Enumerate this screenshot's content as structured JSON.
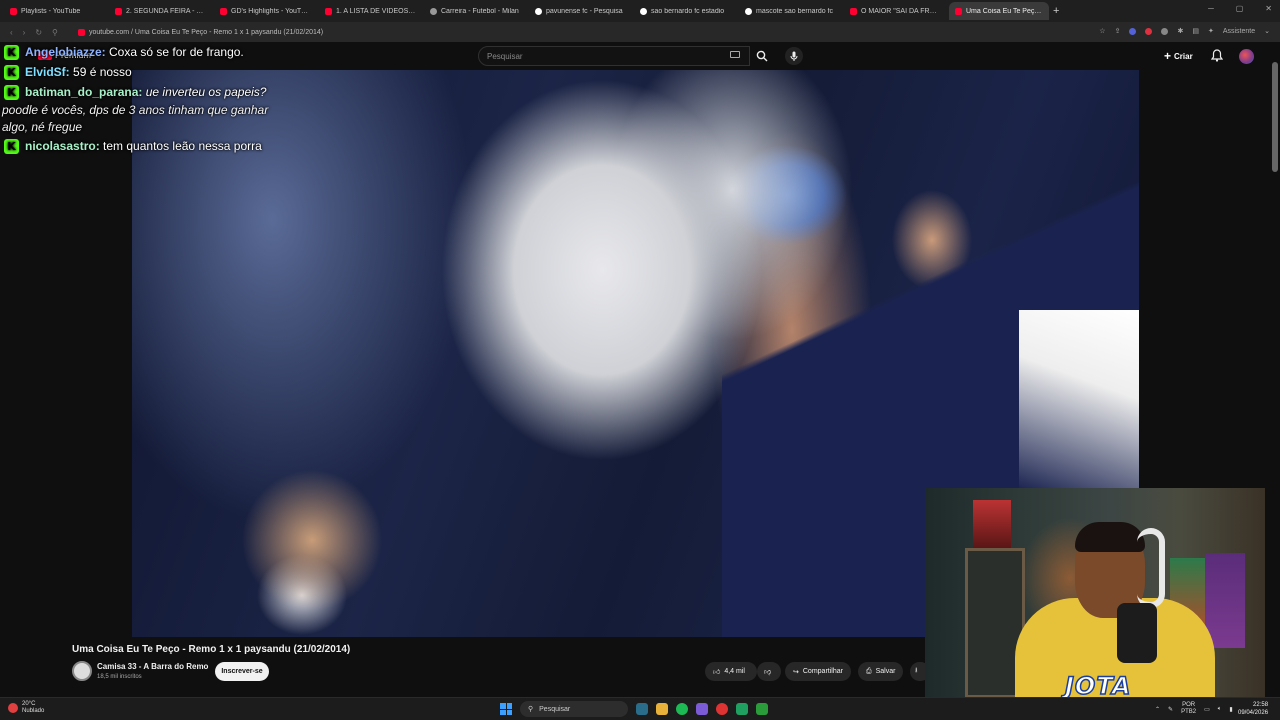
{
  "browser": {
    "tabs": [
      {
        "label": "Playlists - YouTube",
        "icon": "youtube-icon",
        "active": false
      },
      {
        "label": "2. SEGUNDA FEIRA - YouTube",
        "icon": "youtube-icon",
        "active": false
      },
      {
        "label": "GD's Highlights - YouTube",
        "icon": "youtube-icon",
        "active": false
      },
      {
        "label": "1. A LISTA DE VIDEOS PA",
        "icon": "youtube-icon",
        "active": false
      },
      {
        "label": "Carreira - Futebol - Milan",
        "icon": "page-icon",
        "active": false
      },
      {
        "label": "pavunense fc - Pesquisa",
        "icon": "google-icon",
        "active": false
      },
      {
        "label": "sao bernardo fc estadio",
        "icon": "google-icon",
        "active": false
      },
      {
        "label": "mascote sao bernardo fc",
        "icon": "google-icon",
        "active": false
      },
      {
        "label": "O MAIOR \"SAI DA FRENTE\"",
        "icon": "youtube-icon",
        "active": false
      },
      {
        "label": "Uma Coisa Eu Te Peço - R",
        "icon": "youtube-icon",
        "active": true
      }
    ],
    "new_tab": "+",
    "url": "youtube.com / Uma Coisa Eu Te Peço - Remo 1 x 1 paysandu (21/02/2014)",
    "assistant_label": "Assistente"
  },
  "youtube": {
    "logo_label": "Premium",
    "search_placeholder": "Pesquisar",
    "create_label": "Criar",
    "video_title": "Uma Coisa Eu Te Peço - Remo 1 x 1 paysandu (21/02/2014)",
    "channel_name": "Camisa 33 - A Barra do Remo",
    "channel_subs": "18,5 mil inscritos",
    "subscribe_label": "Inscrever-se",
    "likes": "4,4 mil",
    "share_label": "Compartilhar",
    "save_label": "Salvar"
  },
  "chat": [
    {
      "user": "Angelobiazze:",
      "user_color": "#8fb4ff",
      "text": "Coxa só se for de frango.",
      "italic": false
    },
    {
      "user": "ElvidSf:",
      "user_color": "#7fe0ff",
      "text": "59 é nosso",
      "italic": false
    },
    {
      "user": "batiman_do_parana:",
      "user_color": "#a8f0c8",
      "text": "ue inverteu os papeis?",
      "italic": true,
      "wrap": [
        "poodle é vocês, dps de 3 anos tinham que ganhar",
        "algo, né fregue"
      ]
    },
    {
      "user": "nicolasastro:",
      "user_color": "#a8f0c8",
      "text": "tem quantos leão nessa porra",
      "italic": false
    }
  ],
  "kick_badge": "K",
  "streamer_logo": "JOTA",
  "taskbar": {
    "weather_temp": "20°C",
    "weather_desc": "Nublado",
    "search_label": "Pesquisar",
    "lang_top": "POR",
    "lang_bottom": "PTB2",
    "time": "22:58",
    "date": "09/04/2026"
  },
  "colors": {
    "youtube_red": "#ff0033",
    "kick_green": "#53fc18",
    "background": "#0f0f0f"
  }
}
